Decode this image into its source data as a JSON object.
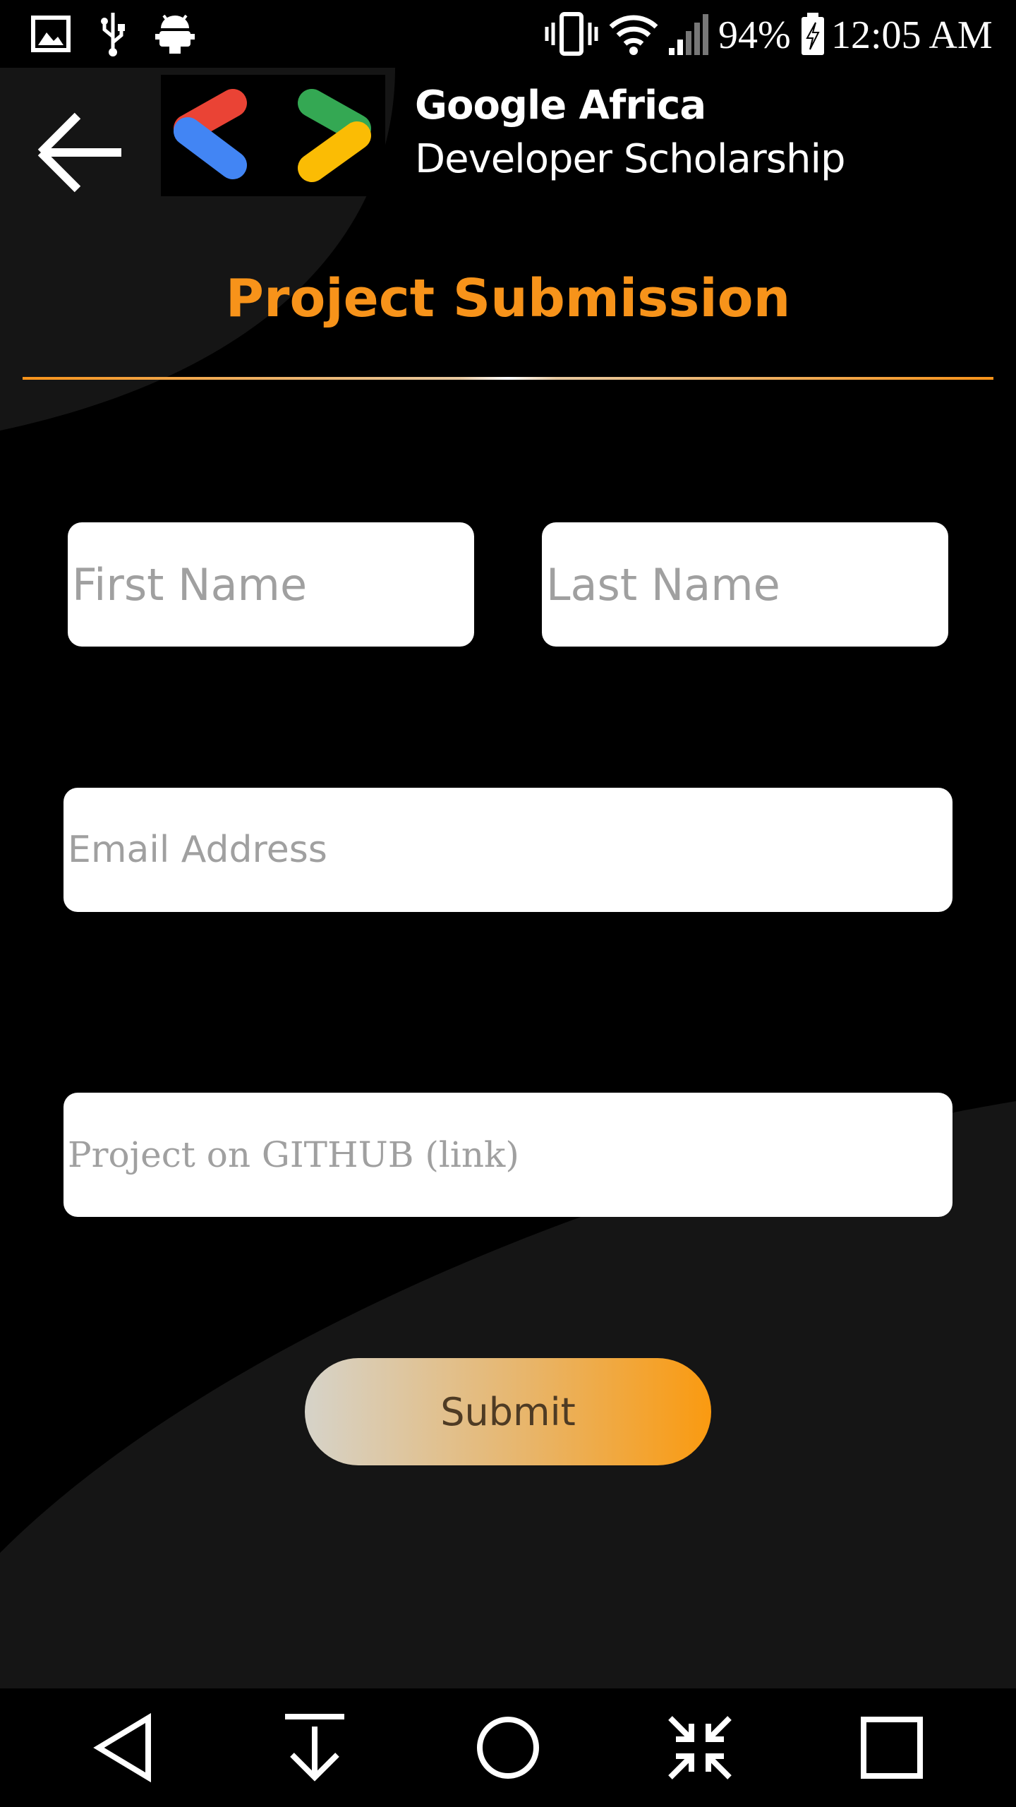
{
  "status_bar": {
    "icons": [
      "image-icon",
      "usb-icon",
      "android-debug-icon",
      "vibrate-icon",
      "wifi-icon",
      "signal-icon",
      "battery-charging-icon"
    ],
    "battery_percent": "94%",
    "time": "12:05 AM"
  },
  "header": {
    "back_icon": "arrow-left-icon",
    "logo_line1": "Google Africa",
    "logo_line2": "Developer Scholarship",
    "logo_colors": [
      "#ea4335",
      "#4285f4",
      "#34a853",
      "#fbbc04"
    ]
  },
  "page": {
    "title": "Project Submission"
  },
  "form": {
    "first_name_placeholder": "First Name",
    "last_name_placeholder": "Last Name",
    "email_placeholder": "Email Address",
    "github_placeholder": "Project on GITHUB (link)",
    "submit_label": "Submit"
  },
  "nav_bar": {
    "buttons": [
      "back-triangle-icon",
      "notifications-down-icon",
      "home-circle-icon",
      "minimize-icon",
      "recents-square-icon"
    ]
  },
  "colors": {
    "accent": "#f7931a",
    "background": "#000000",
    "shape": "#151515",
    "field": "#ffffff",
    "placeholder": "#a0a0a0"
  }
}
